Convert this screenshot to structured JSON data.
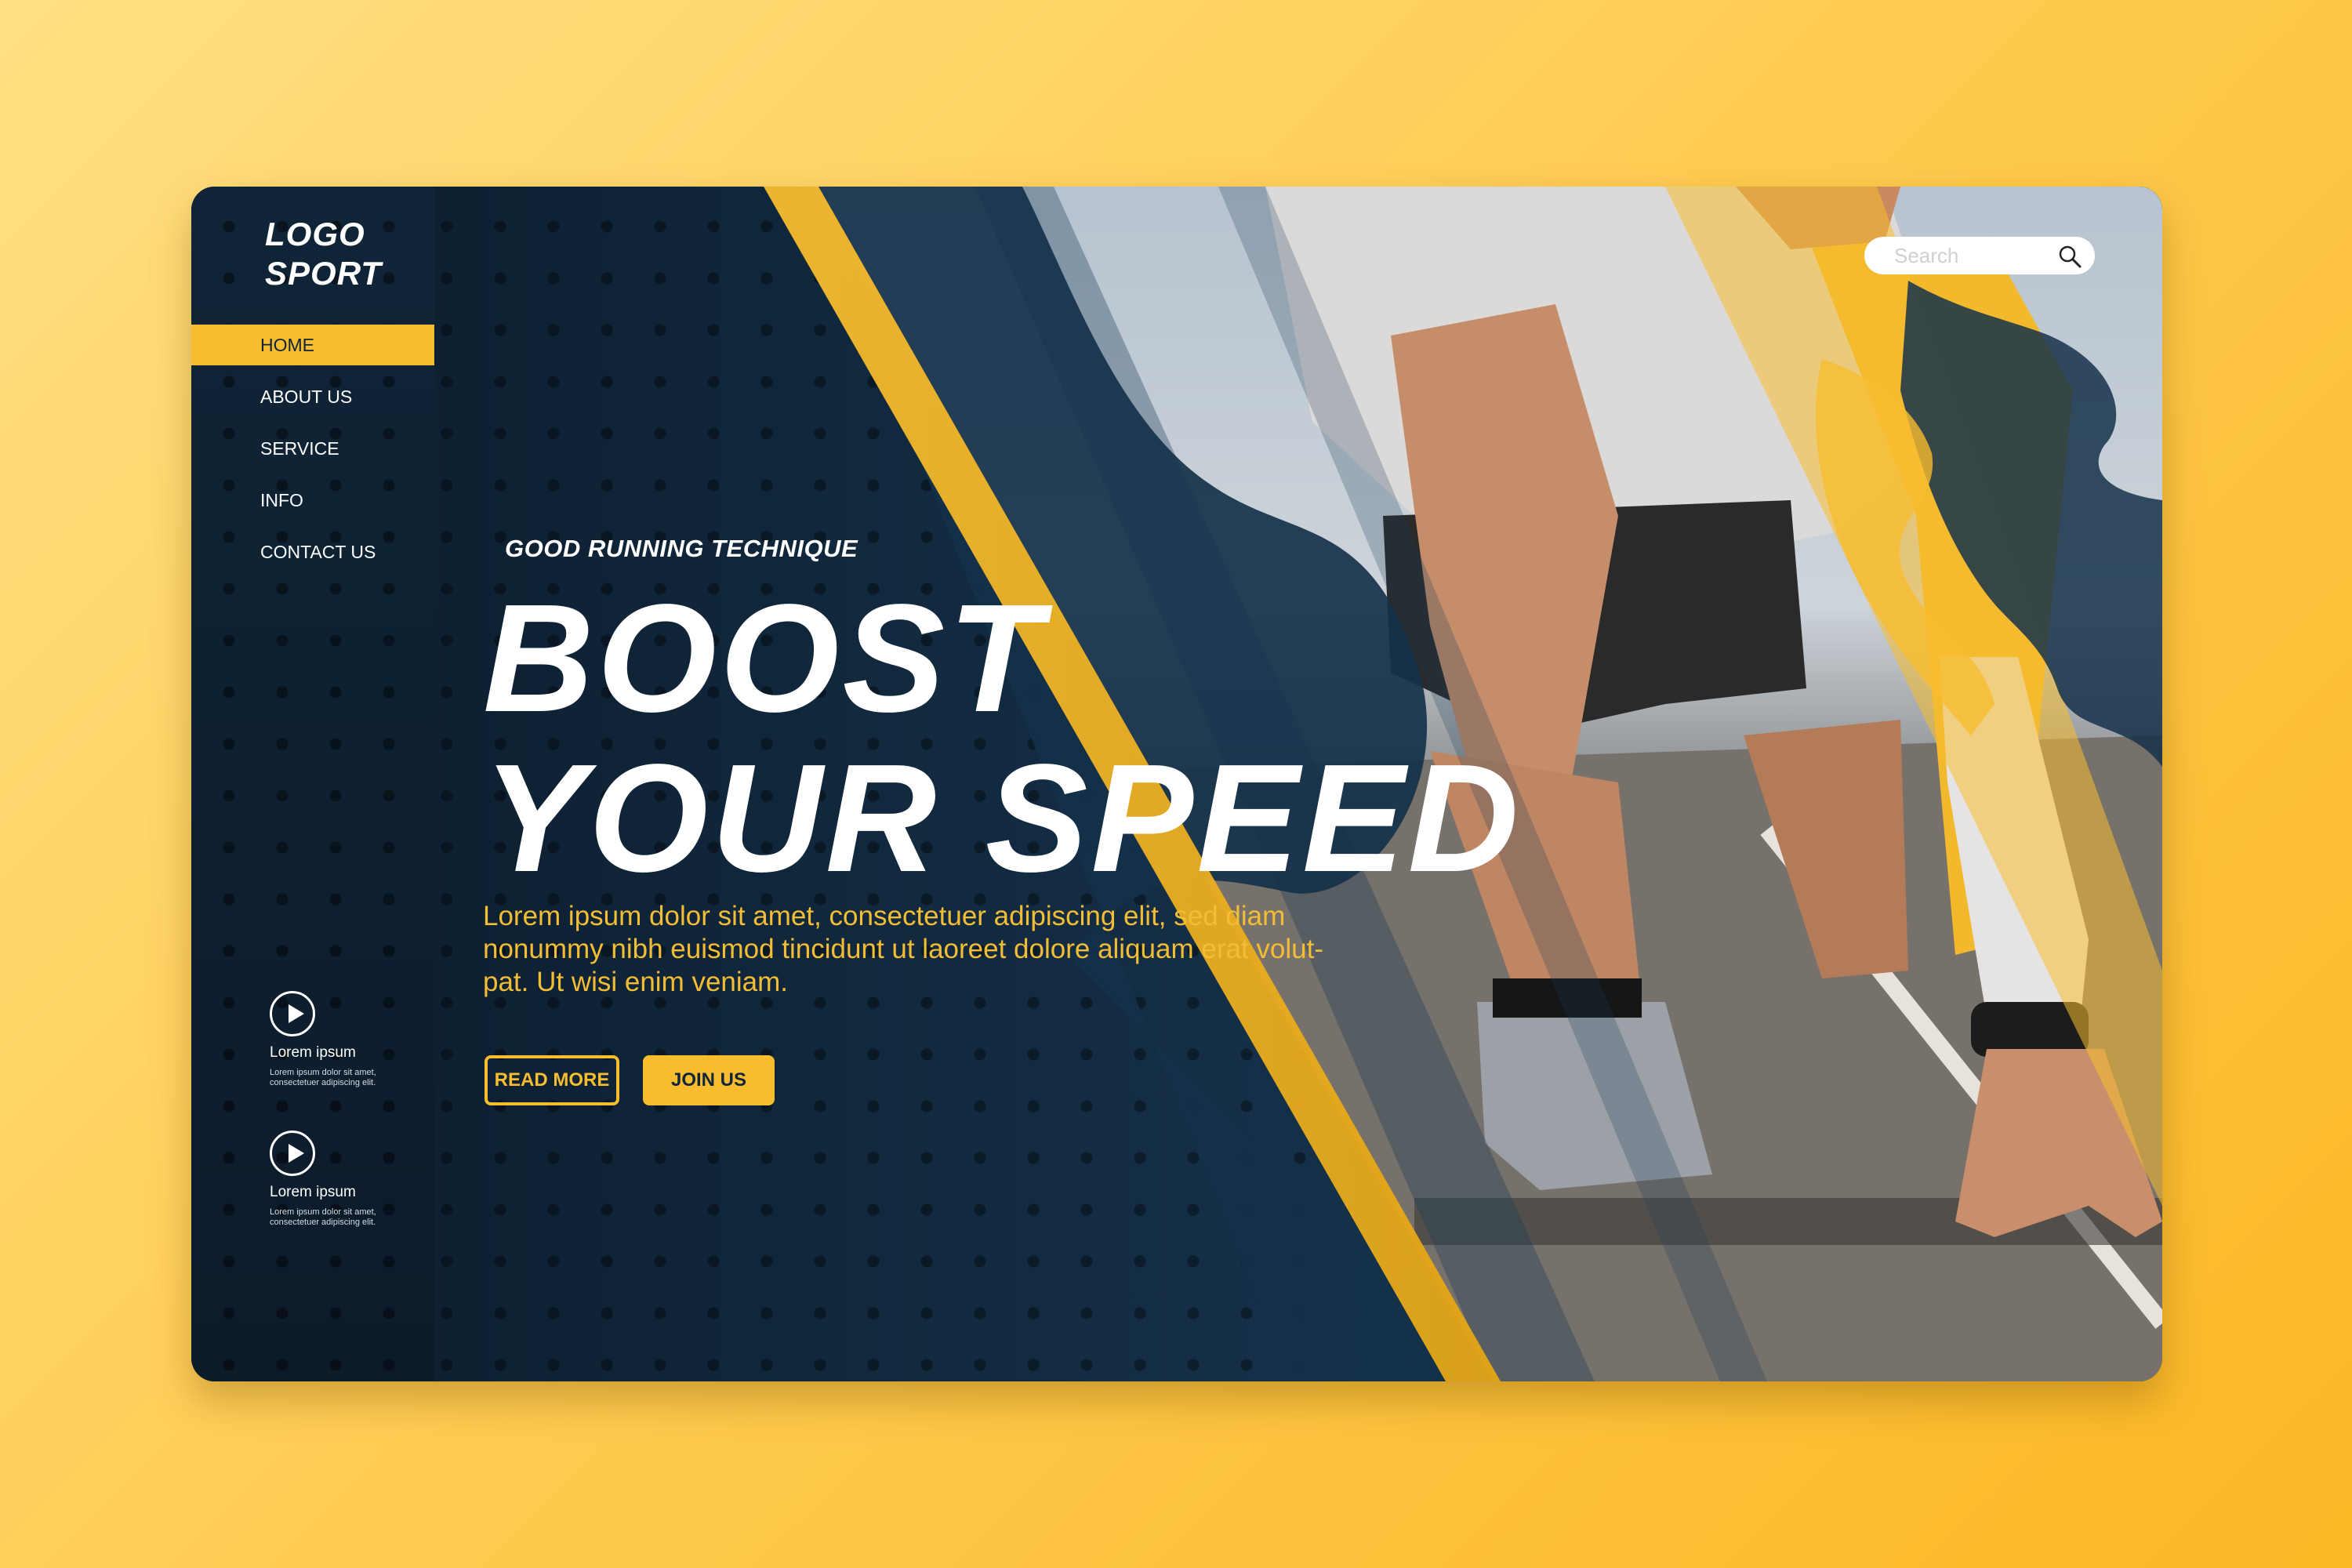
{
  "brand": {
    "logo_line1": "LOGO",
    "logo_line2": "SPORT"
  },
  "nav": {
    "items": [
      {
        "label": "HOME",
        "active": true
      },
      {
        "label": "ABOUT US"
      },
      {
        "label": "SERVICE"
      },
      {
        "label": "INFO"
      },
      {
        "label": "CONTACT US"
      }
    ]
  },
  "features": [
    {
      "title": "Lorem ipsum",
      "text": "Lorem ipsum dolor sit amet, consectetuer adipiscing elit.",
      "icon": "play-icon"
    },
    {
      "title": "Lorem ipsum",
      "text": "Lorem ipsum dolor sit amet, consectetuer adipiscing elit.",
      "icon": "play-icon"
    }
  ],
  "hero": {
    "tagline": "GOOD RUNNING TECHNIQUE",
    "headline_line1": "BOOST",
    "headline_line2": "YOUR SPEED",
    "body": "Lorem ipsum dolor sit amet, consectetuer adipiscing elit, sed diam nonummy nibh euismod tincidunt ut laoreet dolore  aliquam erat volut-pat. Ut wisi enim veniam.",
    "read_more_label": "READ MORE",
    "join_label": "JOIN US"
  },
  "search": {
    "placeholder": "Search",
    "icon": "search-icon"
  },
  "colors": {
    "accent": "#f7bd2f",
    "navy": "#10253a",
    "background": "#ffcd55"
  }
}
